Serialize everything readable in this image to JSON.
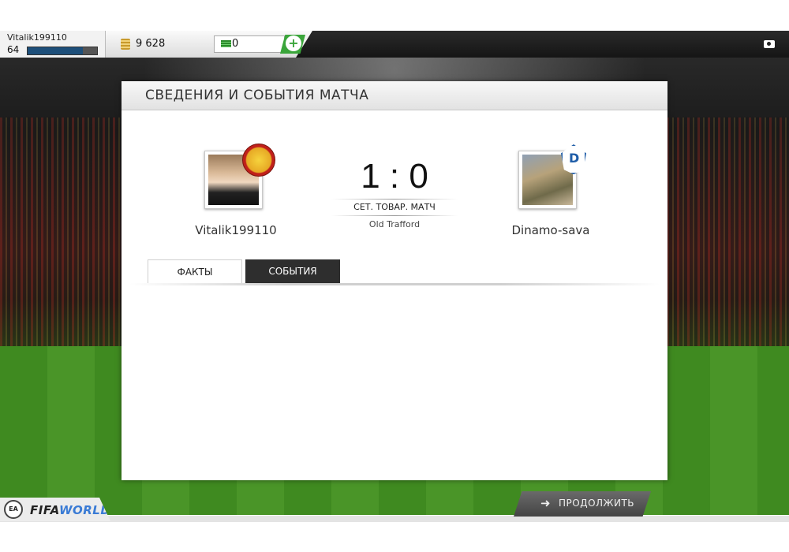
{
  "topbar": {
    "player_name": "Vitalik199110",
    "level": "64",
    "xp_fraction": 0.8,
    "coins": "9 628",
    "points": "0",
    "add_label": "+",
    "camera_icon": "camera-icon",
    "coin_icon": "coin-icon",
    "points_icon": "points-icon"
  },
  "dialog": {
    "title": "СВЕДЕНИЯ И СОБЫТИЯ МАТЧА",
    "home": {
      "name": "Vitalik199110",
      "badge": "Manchester United"
    },
    "away": {
      "name": "Dinamo-sava",
      "badge_letter": "D"
    },
    "score": "1 : 0",
    "match_type": "СЕТ. ТОВАР. МАТЧ",
    "venue": "Old Trafford",
    "tabs": [
      {
        "label": "ФАКТЫ",
        "active": false
      },
      {
        "label": "СОБЫТИЯ",
        "active": true
      }
    ]
  },
  "bottom": {
    "ea_text": "EA SPORTS",
    "logo_fifa": "FIFA",
    "logo_world": "WORLD",
    "continue_label": "ПРОДОЛЖИТЬ",
    "continue_icon": "arrow-right-icon"
  }
}
